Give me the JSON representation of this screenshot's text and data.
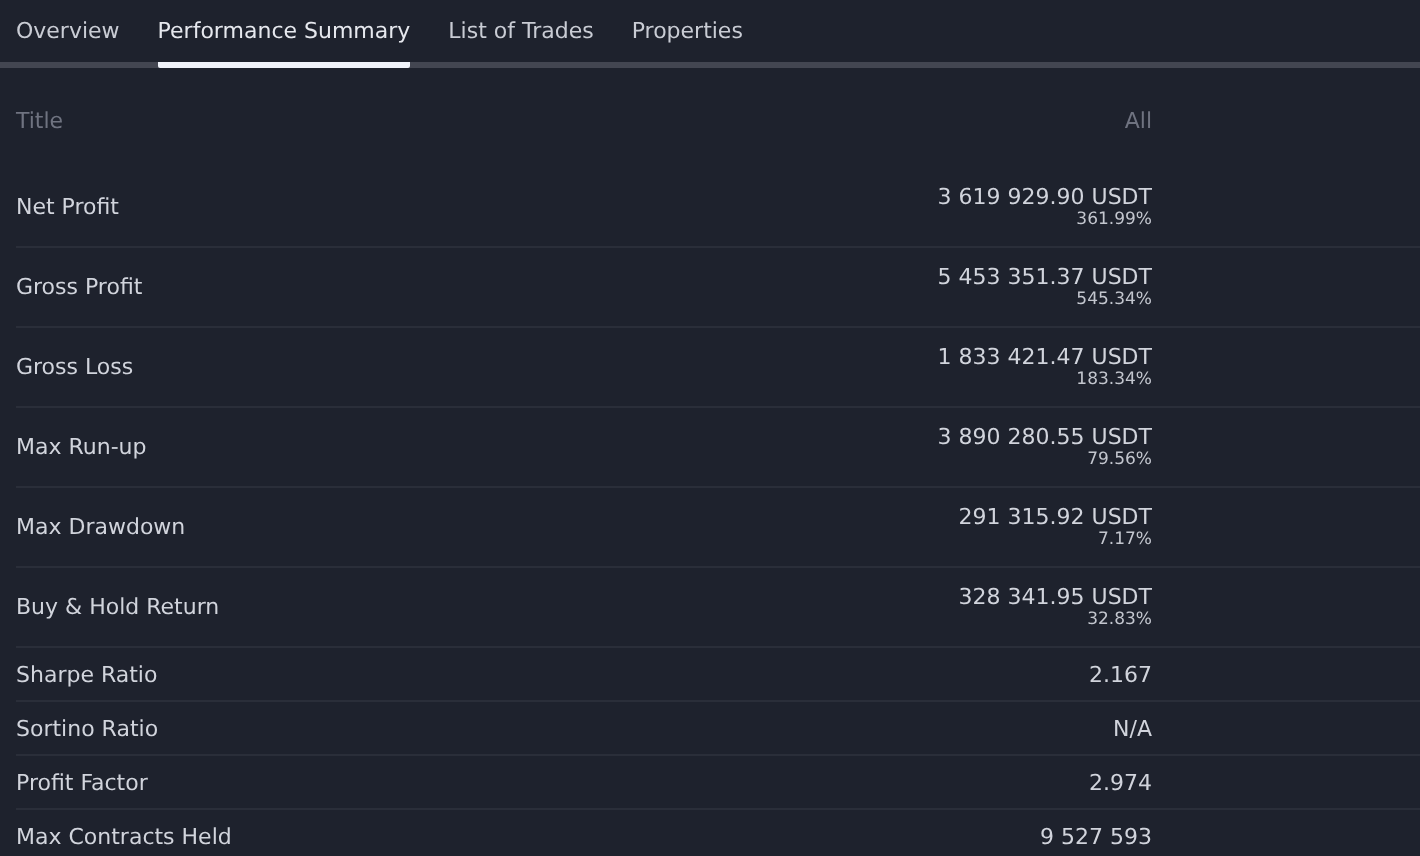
{
  "tabs": [
    {
      "label": "Overview",
      "selected": false
    },
    {
      "label": "Performance Summary",
      "selected": true
    },
    {
      "label": "List of Trades",
      "selected": false
    },
    {
      "label": "Properties",
      "selected": false
    }
  ],
  "table": {
    "columns": [
      "Title",
      "All"
    ],
    "rows": [
      {
        "title": "Net Profit",
        "value": "3 619 929.90 USDT",
        "percent": "361.99%"
      },
      {
        "title": "Gross Profit",
        "value": "5 453 351.37 USDT",
        "percent": "545.34%"
      },
      {
        "title": "Gross Loss",
        "value": "1 833 421.47 USDT",
        "percent": "183.34%"
      },
      {
        "title": "Max Run-up",
        "value": "3 890 280.55 USDT",
        "percent": "79.56%"
      },
      {
        "title": "Max Drawdown",
        "value": "291 315.92 USDT",
        "percent": "7.17%"
      },
      {
        "title": "Buy & Hold Return",
        "value": "328 341.95 USDT",
        "percent": "32.83%"
      },
      {
        "title": "Sharpe Ratio",
        "value": "2.167"
      },
      {
        "title": "Sortino Ratio",
        "value": "N/A"
      },
      {
        "title": "Profit Factor",
        "value": "2.974"
      },
      {
        "title": "Max Contracts Held",
        "value": "9 527 593"
      }
    ]
  }
}
